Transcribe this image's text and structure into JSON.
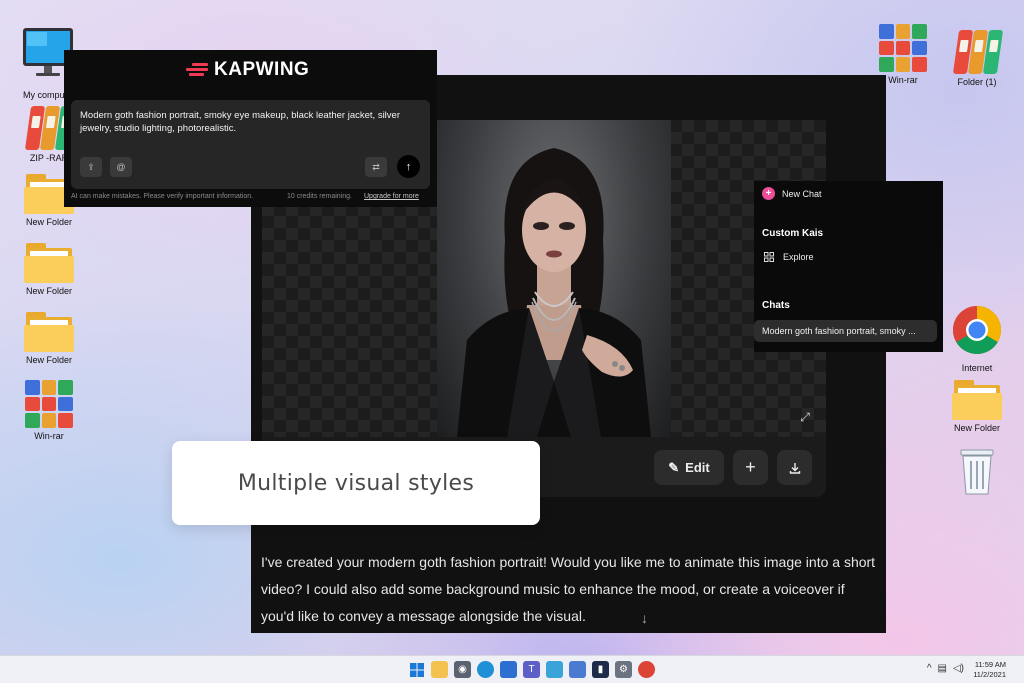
{
  "desktop": {
    "left_icons": [
      {
        "label": "My computer"
      },
      {
        "label": "ZIP -RAR"
      },
      {
        "label": "New Folder"
      },
      {
        "label": "New Folder"
      },
      {
        "label": "New Folder"
      },
      {
        "label": "Win-rar"
      }
    ],
    "right_icons": [
      {
        "label": "Win-rar"
      },
      {
        "label": "Folder (1)"
      },
      {
        "label": "Internet"
      },
      {
        "label": "New Folder"
      },
      {
        "label": "Recycle Bin"
      }
    ]
  },
  "kapwing": {
    "logo_text": "KAPWING",
    "prompt_text": "Modern goth fashion portrait, smoky eye makeup, black leather jacket, silver jewelry, studio lighting, photorealistic.",
    "disclaimer": "AI can make mistakes. Please verify important information.",
    "credits": "10 credits remaining.",
    "upgrade_link": "Upgrade for more",
    "icons": {
      "upload": "upload-icon",
      "mention": "at-icon",
      "settings": "sliders-icon",
      "send": "arrow-up-icon"
    }
  },
  "chat_sidebar": {
    "new_chat": "New Chat",
    "custom_kais": "Custom Kais",
    "explore": "Explore",
    "chats": "Chats",
    "chat_items": [
      "Modern goth fashion portrait, smoky ..."
    ]
  },
  "editor": {
    "edit_label": "Edit",
    "reply": "I've created your modern goth fashion portrait! Would you like me to animate this image into a short video? I could also add some background music to enhance the mood, or create a voiceover if you'd like to convey a message alongside the visual."
  },
  "callout": {
    "text": "Multiple visual styles"
  },
  "taskbar": {
    "time": "11:59 AM",
    "date": "11/2/2021"
  },
  "colors": {
    "brand_red": "#ee3b53",
    "accent_pink": "#ec4f97",
    "window_dark": "#111111"
  }
}
